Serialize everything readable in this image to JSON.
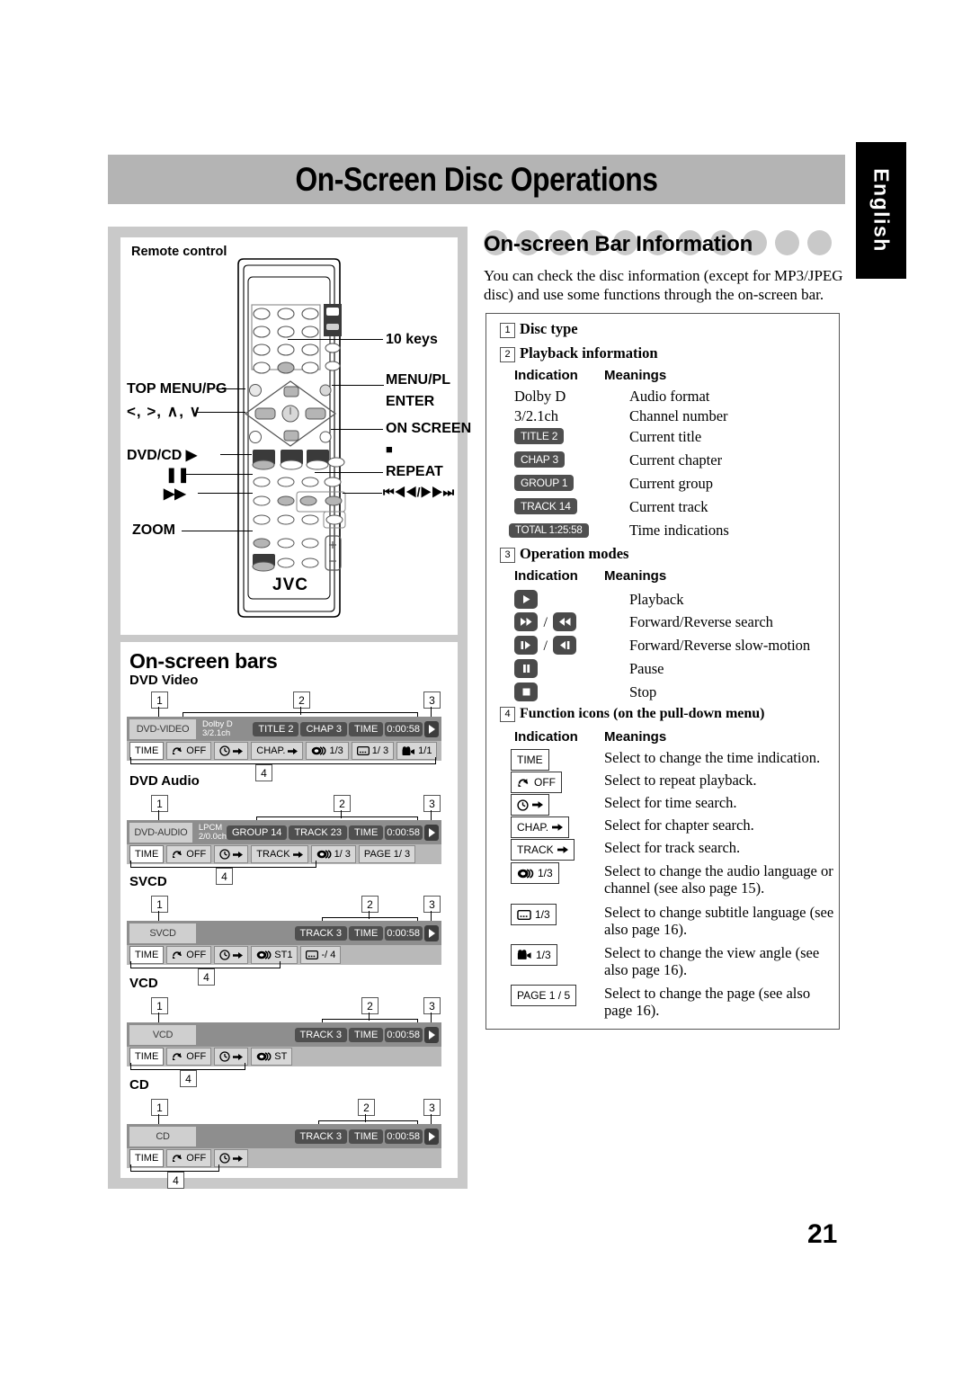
{
  "page": {
    "title": "On-Screen Disc Operations",
    "language_tab": "English",
    "page_number": "21"
  },
  "remote_panel": {
    "caption": "Remote control",
    "brand": "JVC",
    "labels_left": [
      {
        "key": "top-menu-pg",
        "text": "TOP MENU/PG"
      },
      {
        "key": "arrows",
        "text": "<, >, ∧, ∨"
      },
      {
        "key": "dvd-cd-play",
        "text": "DVD/CD ▶"
      },
      {
        "key": "pause",
        "text": "❚❚"
      },
      {
        "key": "fast-forward",
        "text": "▶▶"
      },
      {
        "key": "zoom",
        "text": "ZOOM"
      }
    ],
    "labels_right": [
      {
        "key": "ten-keys",
        "text": "10 keys"
      },
      {
        "key": "menu-pl",
        "text": "MENU/PL"
      },
      {
        "key": "enter",
        "text": "ENTER"
      },
      {
        "key": "on-screen",
        "text": "ON SCREEN"
      },
      {
        "key": "stop",
        "text": "■"
      },
      {
        "key": "repeat",
        "text": "REPEAT"
      },
      {
        "key": "skip",
        "text": "⏮◀◀/▶▶⏭"
      }
    ]
  },
  "onscreen_bars": {
    "section_title": "On-screen bars",
    "callouts": [
      "1",
      "2",
      "3",
      "4"
    ],
    "bars": [
      {
        "caption": "DVD Video",
        "disc_tag": "DVD-VIDEO",
        "format_line1": "Dolby D",
        "format_line2": "3/2.1ch",
        "info": [
          "TITLE 2",
          "CHAP 3"
        ],
        "time_label": "TIME",
        "time_value": "0:00:58",
        "functions": [
          "TIME",
          "OFF",
          "time-search",
          "CHAP.",
          "audio 1/3",
          "subtitle 1/ 3",
          "angle 1/1"
        ]
      },
      {
        "caption": "DVD Audio",
        "disc_tag": "DVD-AUDIO",
        "format_line1": "LPCM",
        "format_line2": "2/0.0ch",
        "info": [
          "GROUP 14",
          "TRACK 23"
        ],
        "time_label": "TIME",
        "time_value": "0:00:58",
        "functions": [
          "TIME",
          "OFF",
          "time-search",
          "TRACK",
          "audio 1/ 3",
          "PAGE 1/ 3"
        ]
      },
      {
        "caption": "SVCD",
        "disc_tag": "SVCD",
        "format_line1": "",
        "format_line2": "",
        "info": [
          "TRACK 3"
        ],
        "time_label": "TIME",
        "time_value": "0:00:58",
        "functions": [
          "TIME",
          "OFF",
          "time-search",
          "audio ST1",
          "subtitle -/ 4"
        ]
      },
      {
        "caption": "VCD",
        "disc_tag": "VCD",
        "format_line1": "",
        "format_line2": "",
        "info": [
          "TRACK 3"
        ],
        "time_label": "TIME",
        "time_value": "0:00:58",
        "functions": [
          "TIME",
          "OFF",
          "time-search",
          "audio ST"
        ]
      },
      {
        "caption": "CD",
        "disc_tag": "CD",
        "format_line1": "",
        "format_line2": "",
        "info": [
          "TRACK 3"
        ],
        "time_label": "TIME",
        "time_value": "0:00:58",
        "functions": [
          "TIME",
          "OFF",
          "time-search"
        ]
      }
    ],
    "fn_labels": {
      "time": "TIME",
      "repeat_off": "OFF",
      "chap": "CHAP.",
      "track": "TRACK",
      "audio_dvdv": "1/3",
      "audio_dvda": "1/ 3",
      "audio_svcd": "ST1",
      "audio_vcd": "ST",
      "subtitle_dvdv": "1/ 3",
      "subtitle_svcd": "-/ 4",
      "angle_dvdv": "1/1",
      "page_dvda": "PAGE 1/ 3"
    }
  },
  "right_column": {
    "heading": "On-screen Bar Information",
    "intro": "You can check the disc information (except for MP3/JPEG disc) and use some functions through the on-screen bar.",
    "sections": [
      {
        "num": "1",
        "title": "Disc type"
      },
      {
        "num": "2",
        "title": "Playback information"
      },
      {
        "num": "3",
        "title": "Operation modes"
      },
      {
        "num": "4",
        "title": "Function icons (on the pull-down menu)"
      }
    ],
    "col_headers": {
      "indication": "Indication",
      "meanings": "Meanings"
    },
    "playback_rows": [
      {
        "kind": "text",
        "indication": "Dolby D",
        "meaning": "Audio format"
      },
      {
        "kind": "text",
        "indication": "3/2.1ch",
        "meaning": "Channel number"
      },
      {
        "kind": "pill",
        "indication": "TITLE  2",
        "meaning": "Current title"
      },
      {
        "kind": "pill",
        "indication": "CHAP  3",
        "meaning": "Current chapter"
      },
      {
        "kind": "pill",
        "indication": "GROUP 1",
        "meaning": "Current group"
      },
      {
        "kind": "pill",
        "indication": "TRACK 14",
        "meaning": "Current track"
      },
      {
        "kind": "pill",
        "indication": "TOTAL 1:25:58",
        "meaning": "Time indications"
      }
    ],
    "operation_rows": [
      {
        "icons": [
          "play"
        ],
        "meaning": "Playback"
      },
      {
        "icons": [
          "ffwd",
          "rew"
        ],
        "meaning": "Forward/Reverse search"
      },
      {
        "icons": [
          "slow-fwd",
          "slow-rev"
        ],
        "meaning": "Forward/Reverse slow-motion"
      },
      {
        "icons": [
          "pause"
        ],
        "meaning": "Pause"
      },
      {
        "icons": [
          "stop"
        ],
        "meaning": "Stop"
      }
    ],
    "function_rows": [
      {
        "icon": "time",
        "label": "TIME",
        "meaning": "Select to change the time indication."
      },
      {
        "icon": "repeat",
        "label": "OFF",
        "meaning": "Select to repeat playback."
      },
      {
        "icon": "time-search",
        "label": "",
        "meaning": "Select for time search."
      },
      {
        "icon": "chap-search",
        "label": "CHAP.",
        "meaning": "Select for chapter search."
      },
      {
        "icon": "track-search",
        "label": "TRACK",
        "meaning": "Select for track search."
      },
      {
        "icon": "audio",
        "label": "1/3",
        "meaning": "Select to change the audio language or channel (see also page 15)."
      },
      {
        "icon": "subtitle",
        "label": "1/3",
        "meaning": "Select to change subtitle language (see also page 16)."
      },
      {
        "icon": "angle",
        "label": "1/3",
        "meaning": "Select to change the view angle (see also page 16)."
      },
      {
        "icon": "page",
        "label": "PAGE 1 / 5",
        "meaning": "Select to change the page (see also page 16)."
      }
    ]
  }
}
